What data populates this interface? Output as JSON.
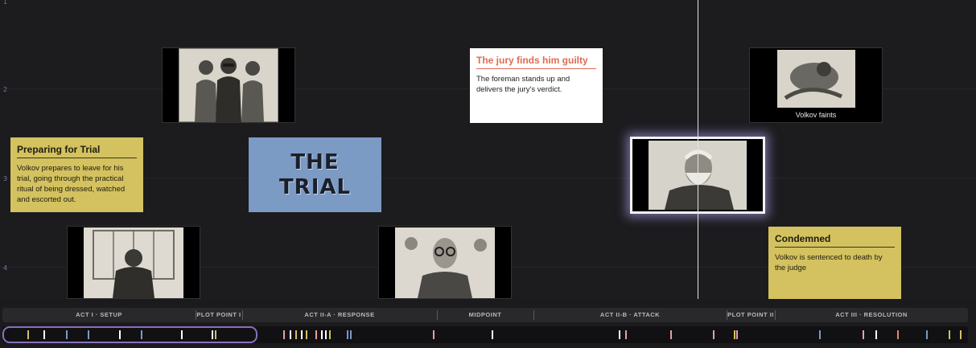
{
  "rows": [
    "1",
    "2",
    "3",
    "4"
  ],
  "notes": {
    "jury": {
      "title": "The jury finds him guilty",
      "body": "The foreman stands up and delivers the jury's verdict."
    },
    "preparing": {
      "title": "Preparing for Trial",
      "body": "Volkov prepares to leave for his trial, going through the practical ritual of being dressed, watched and escorted out."
    },
    "condemned": {
      "title": "Condemned",
      "body": "Volkov is sentenced to death by the judge"
    }
  },
  "title_card": {
    "text": "THE\nTRIAL"
  },
  "frames": {
    "faints": {
      "caption": "Volkov faints"
    }
  },
  "acts": [
    {
      "label": "ACT I · SETUP"
    },
    {
      "label": "PLOT POINT I"
    },
    {
      "label": "ACT II-A · RESPONSE"
    },
    {
      "label": "MIDPOINT"
    },
    {
      "label": "ACT II-B · ATTACK"
    },
    {
      "label": "PLOT POINT II"
    },
    {
      "label": "ACT III · RESOLUTION"
    }
  ],
  "colors": {
    "accent": "#8a6fbf",
    "note_yellow": "#d3c25f",
    "title_blue": "#7b9ac4",
    "note_title_red": "#e06a52"
  }
}
